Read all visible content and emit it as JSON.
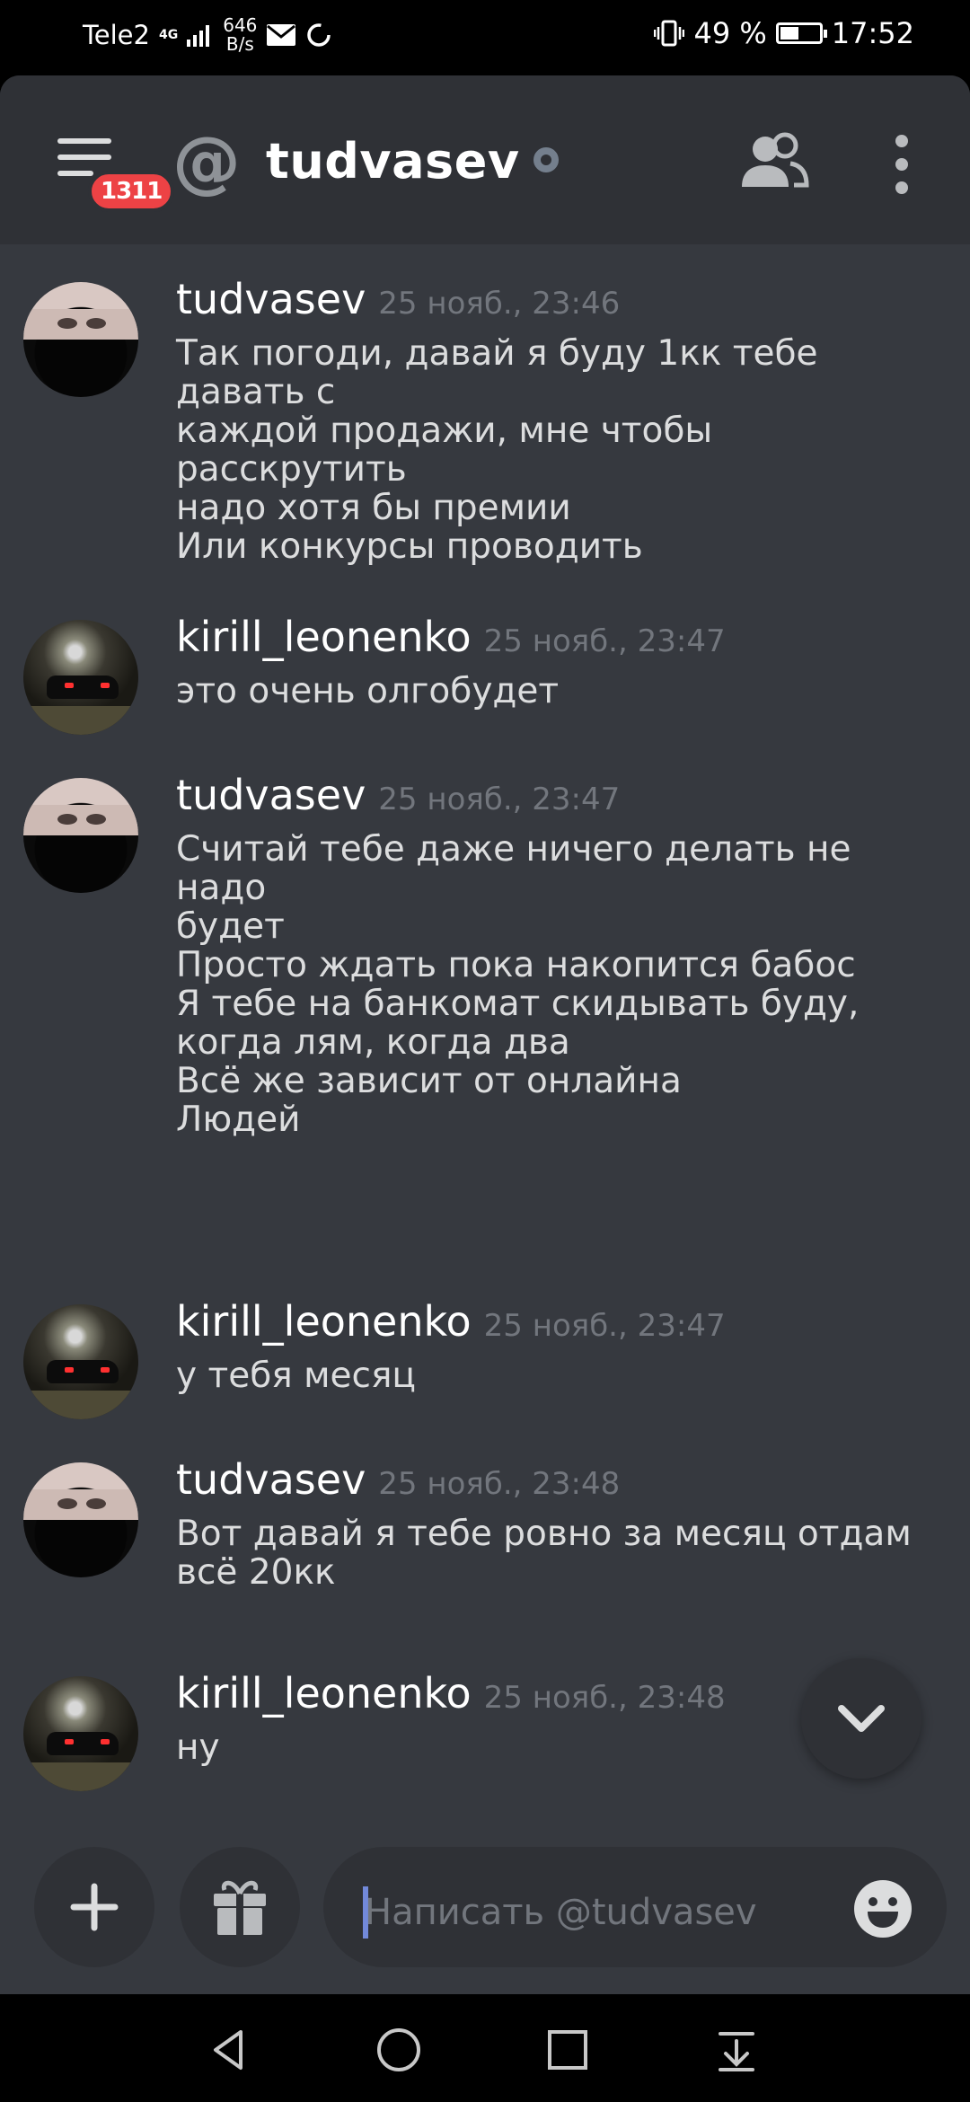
{
  "status_bar": {
    "carrier": "Tele2",
    "network": "4G",
    "speed_value": "646",
    "speed_unit": "B/s",
    "battery": "49 %",
    "battery_level": 0.49,
    "time": "17:52"
  },
  "header": {
    "badge": "1311",
    "title": "tudvasev"
  },
  "messages": [
    {
      "author": "tudvasev",
      "avatar": "mask-avatar",
      "time": "25 нояб., 23:46",
      "lines": [
        "Так погоди, давай я буду 1кк тебе давать с",
        "каждой продажи, мне чтобы расскрутить",
        "надо хотя бы премии",
        "Или конкурсы проводить"
      ]
    },
    {
      "author": "kirill_leonenko",
      "avatar": "car-avatar",
      "time": "25 нояб., 23:47",
      "lines": [
        "это очень олгобудет"
      ]
    },
    {
      "author": "tudvasev",
      "avatar": "mask-avatar",
      "time": "25 нояб., 23:47",
      "lines": [
        "Считай тебе даже ничего делать не надо",
        "будет",
        "Просто ждать пока накопится бабос",
        "Я тебе на банкомат скидывать буду,",
        "когда лям, когда два",
        "Всё же зависит от онлайна",
        "Людей"
      ]
    },
    {
      "author": "kirill_leonenko",
      "avatar": "car-avatar",
      "time": "25 нояб., 23:47",
      "lines": [
        "у тебя месяц"
      ]
    },
    {
      "author": "tudvasev",
      "avatar": "mask-avatar",
      "time": "25 нояб., 23:48",
      "lines": [
        "Вот давай я тебе ровно за месяц отдам",
        "всё 20кк"
      ]
    },
    {
      "author": "kirill_leonenko",
      "avatar": "car-avatar",
      "time": "25 нояб., 23:48",
      "lines": [
        "ну"
      ]
    }
  ],
  "composer": {
    "placeholder": "Написать @tudvasev"
  },
  "icons": {
    "menu": "hamburger-menu-icon",
    "at": "at-icon",
    "members": "members-icon",
    "more": "kebab-menu-icon",
    "add": "plus-icon",
    "gift": "gift-icon",
    "emoji": "emoji-icon",
    "scroll": "chevron-down-icon"
  },
  "colors": {
    "background": "#36393f",
    "header": "#2f3136",
    "badge": "#ed4245",
    "timestamp": "#72767d",
    "accent": "#7289da"
  }
}
